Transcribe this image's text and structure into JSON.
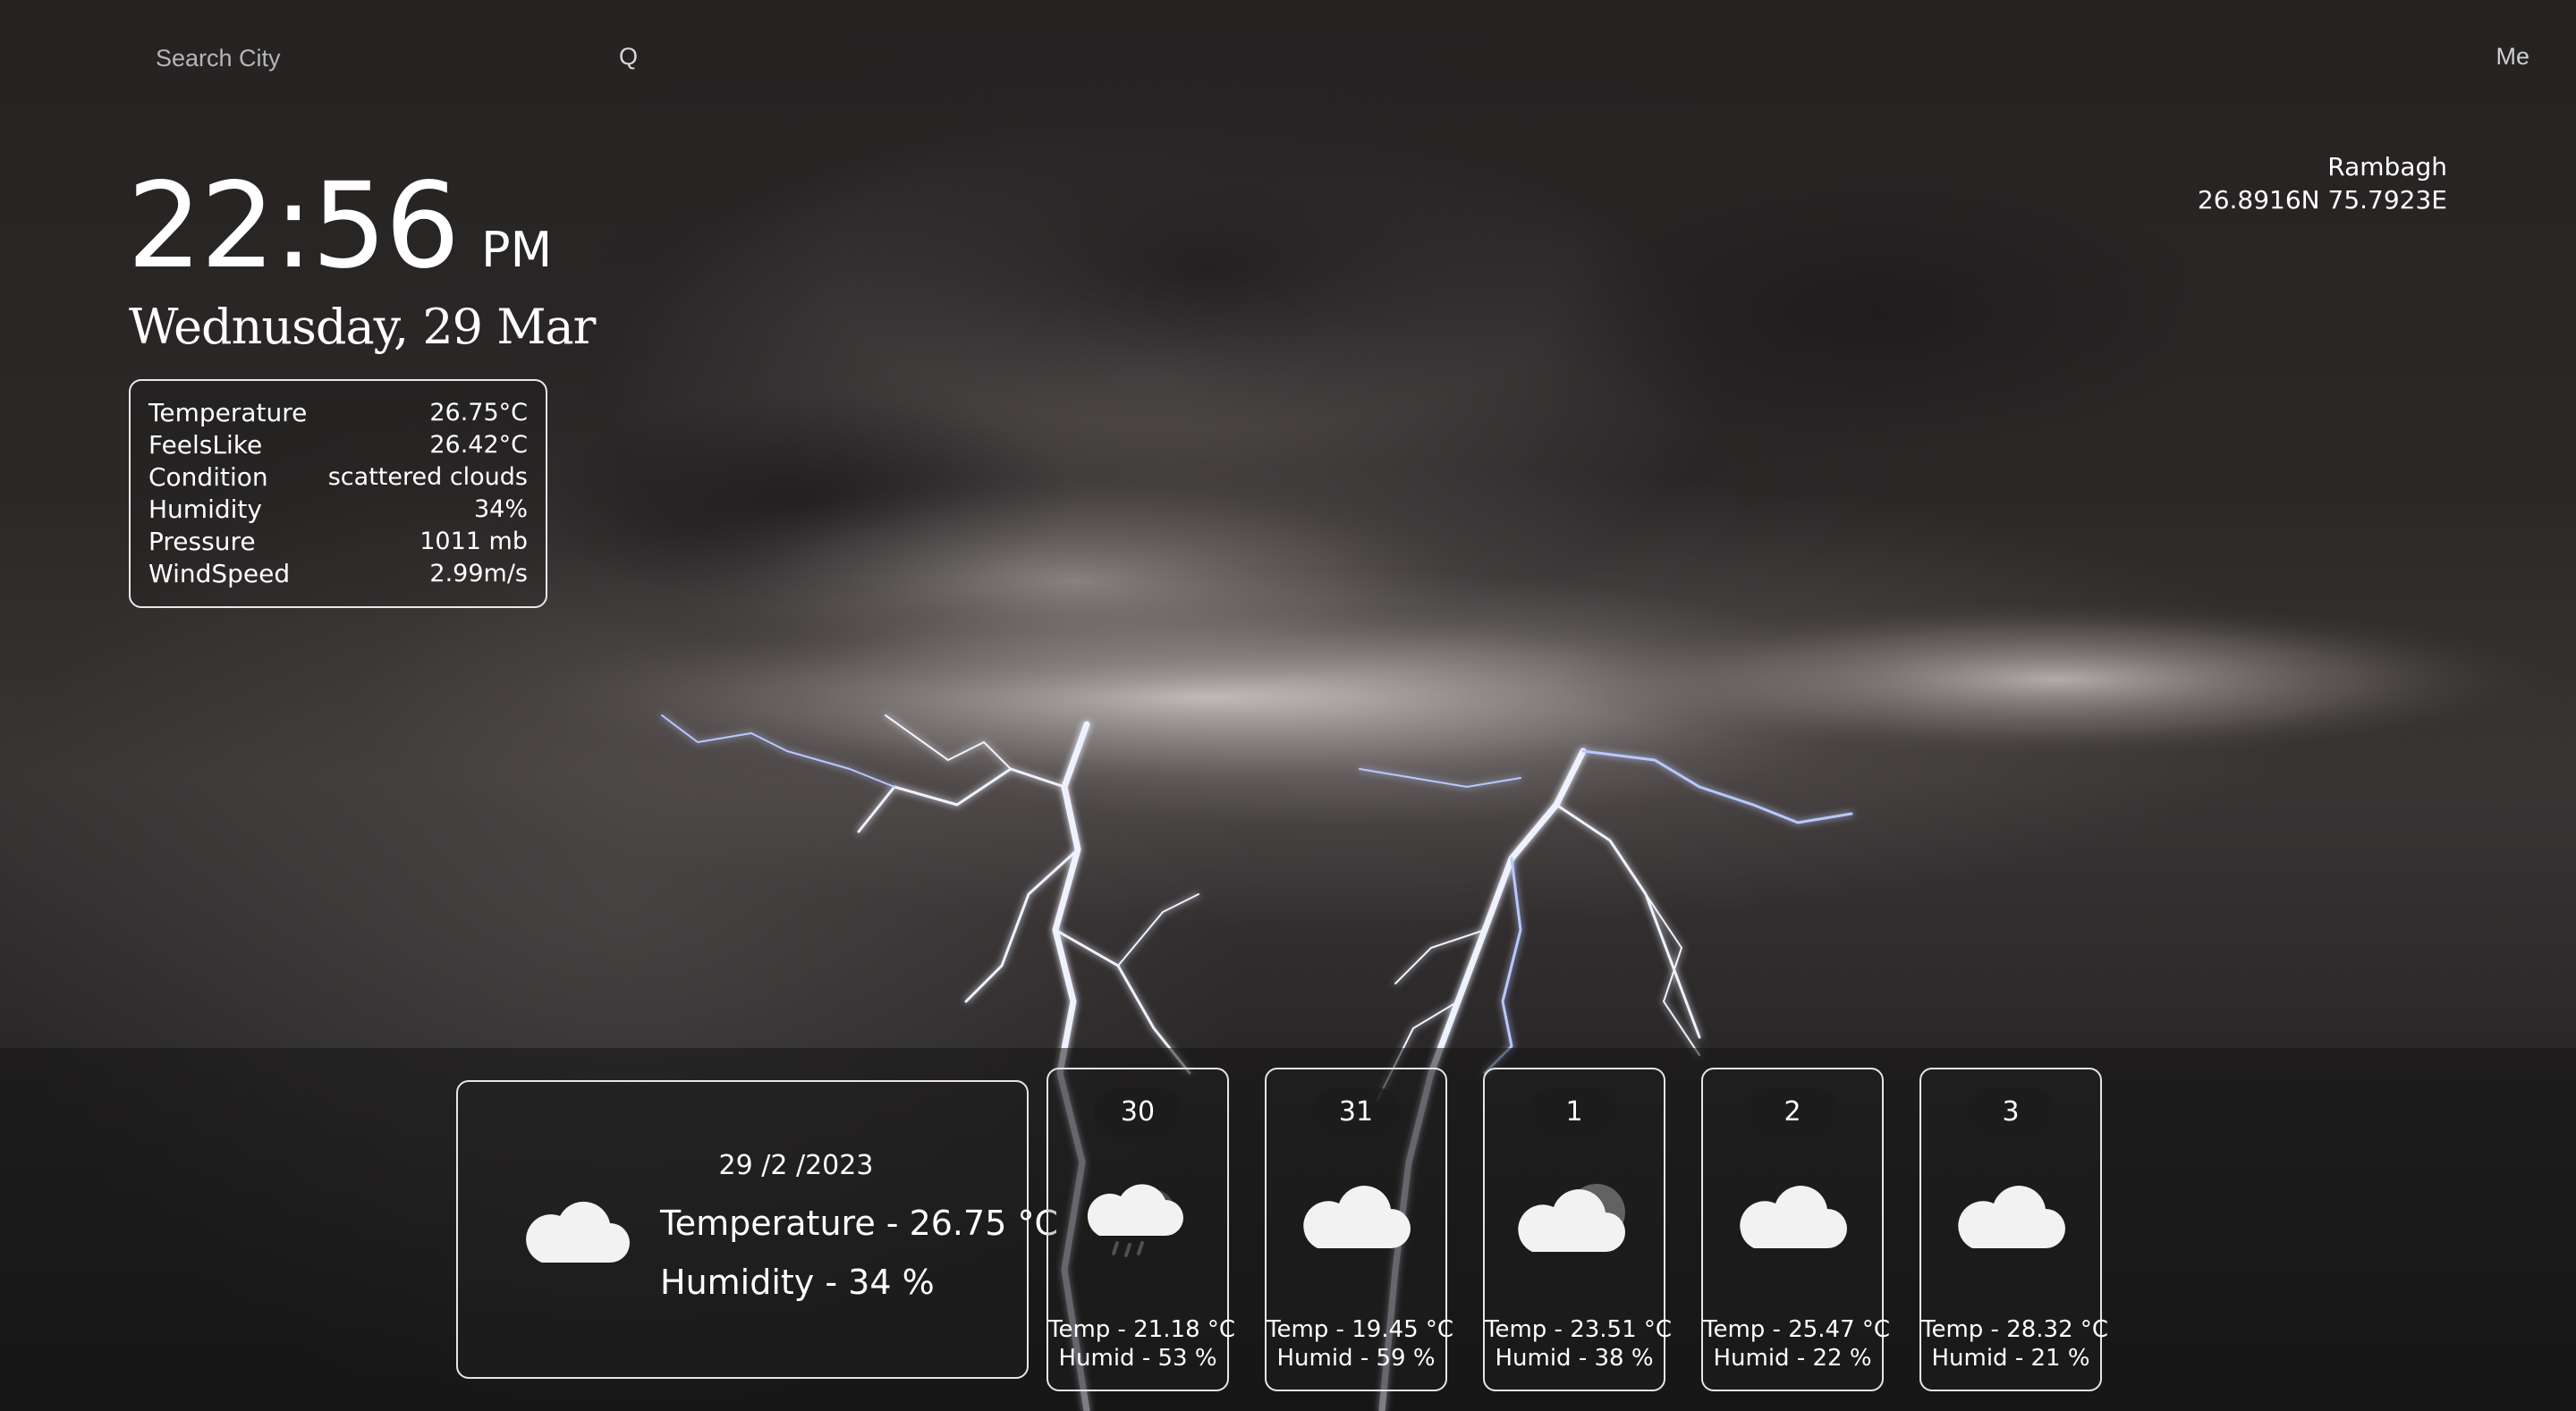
{
  "search": {
    "placeholder": "Search City",
    "button_label": "Q"
  },
  "nav": {
    "me_label": "Me"
  },
  "clock": {
    "time": "22:56",
    "ampm": "PM",
    "date": "Wednusday, 29 Mar"
  },
  "stats": [
    {
      "label": "Temperature",
      "value": "26.75°C"
    },
    {
      "label": "FeelsLike",
      "value": "26.42°C"
    },
    {
      "label": "Condition",
      "value": "scattered clouds"
    },
    {
      "label": "Humidity",
      "value": "34%"
    },
    {
      "label": "Pressure",
      "value": "1011 mb"
    },
    {
      "label": "WindSpeed",
      "value": "2.99m/s"
    }
  ],
  "location": {
    "name": "Rambagh",
    "coords": "26.8916N 75.7923E"
  },
  "today": {
    "date": "29 /2 /2023",
    "icon": "cloud-icon",
    "temperature": "Temperature - 26.75 °C",
    "humidity": "Humidity - 34 %"
  },
  "forecast": [
    {
      "day": "30",
      "icon": "rain-cloud-icon",
      "temp": "Temp - 21.18 °C",
      "humid": "Humid - 53 %"
    },
    {
      "day": "31",
      "icon": "cloud-icon",
      "temp": "Temp - 19.45 °C",
      "humid": "Humid - 59 %"
    },
    {
      "day": "1",
      "icon": "cloud-moon-icon",
      "temp": "Temp - 23.51 °C",
      "humid": "Humid - 38 %"
    },
    {
      "day": "2",
      "icon": "cloud-icon",
      "temp": "Temp - 25.47 °C",
      "humid": "Humid - 22 %"
    },
    {
      "day": "3",
      "icon": "cloud-icon",
      "temp": "Temp - 28.32 °C",
      "humid": "Humid - 21 %"
    }
  ],
  "colors": {
    "text": "#ffffff",
    "border": "#e6e6e6",
    "pill": "#1c1c1c",
    "lightning": "#c9d6ff"
  }
}
